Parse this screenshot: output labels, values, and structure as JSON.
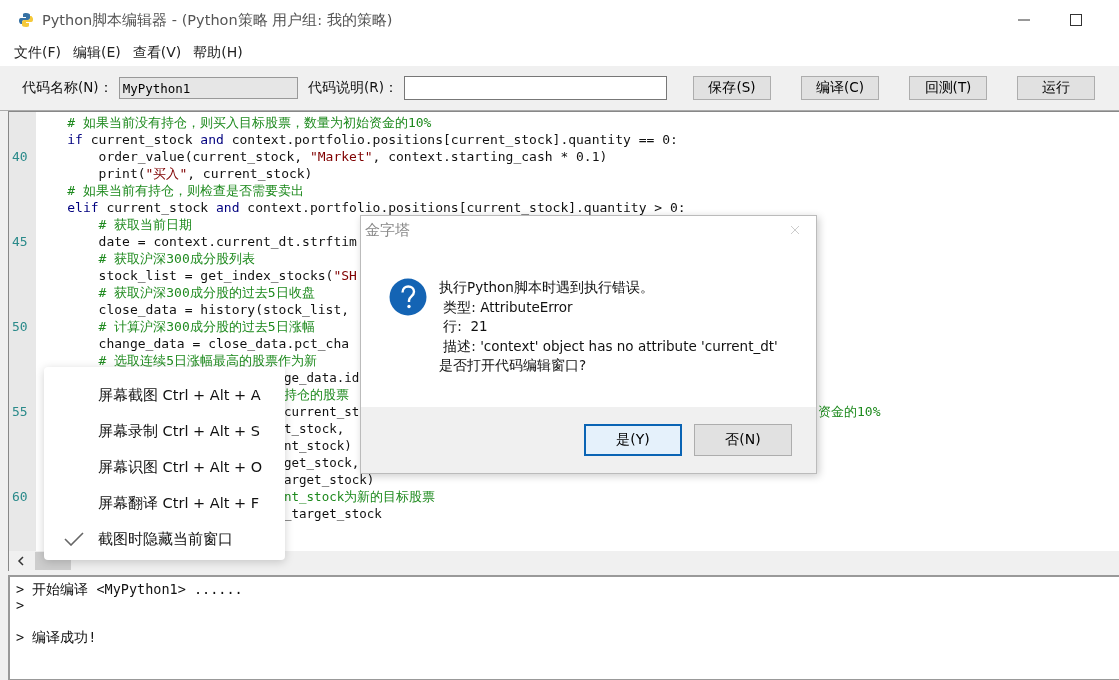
{
  "window": {
    "title": "Python脚本编辑器 - (Python策略 用户组: 我的策略)"
  },
  "menu_bar": [
    "文件(F)",
    "编辑(E)",
    "查看(V)",
    "帮助(H)"
  ],
  "toolbar": {
    "name_label": "代码名称(N)：",
    "name_value": "MyPython1",
    "desc_label": "代码说明(R)：",
    "buttons": [
      "保存(S)",
      "编译(C)",
      "回测(T)",
      "运行"
    ]
  },
  "code_lines": [
    {
      "segments": [
        {
          "kind": "full",
          "tokens": [
            {
              "kind": "comment",
              "t": "# 如果当前没有持仓，则买入目标股票，数量为初始资金的10%"
            }
          ]
        }
      ]
    },
    {
      "segments": [
        {
          "kind": "full",
          "tokens": [
            {
              "kind": "keyword",
              "t": "if"
            },
            {
              "kind": "plain",
              "t": " current_stock "
            },
            {
              "kind": "keyword",
              "t": "and"
            },
            {
              "kind": "plain",
              "t": " context.portfolio.positions[current_stock].quantity == 0:"
            }
          ]
        }
      ],
      "children": [
        {
          "number": "40",
          "segments": [
            {
              "kind": "full",
              "tokens": [
                {
                  "kind": "plain",
                  "t": "order_value(current_stock, "
                },
                {
                  "kind": "string",
                  "t": "\"Market\""
                },
                {
                  "kind": "plain",
                  "t": ", context.starting_cash * 0.1)"
                }
              ]
            }
          ]
        },
        {
          "segments": [
            {
              "kind": "full",
              "tokens": [
                {
                  "kind": "plain",
                  "t": "print("
                },
                {
                  "kind": "string",
                  "t": "\"买入\""
                },
                {
                  "kind": "plain",
                  "t": ", current_stock)"
                }
              ]
            }
          ]
        }
      ]
    },
    {
      "segments": [
        {
          "kind": "full",
          "tokens": [
            {
              "kind": "comment",
              "t": "# 如果当前有持仓，则检查是否需要卖出"
            }
          ]
        }
      ]
    },
    {
      "segments": [
        {
          "kind": "full",
          "tokens": [
            {
              "kind": "keyword",
              "t": "elif"
            },
            {
              "kind": "plain",
              "t": " current_stock "
            },
            {
              "kind": "keyword",
              "t": "and"
            },
            {
              "kind": "plain",
              "t": " context.portfolio.positions[current_stock].quantity > 0:"
            }
          ]
        }
      ],
      "children": [
        {
          "segments": [
            {
              "kind": "full",
              "tokens": [
                {
                  "kind": "comment",
                  "t": "# 获取当前日期"
                }
              ]
            }
          ]
        },
        {
          "number": "45",
          "segments": [
            {
              "kind": "full",
              "tokens": [
                {
                  "kind": "plain",
                  "t": "date = context.current_dt.strftim"
                }
              ]
            }
          ]
        },
        {
          "segments": [
            {
              "kind": "full",
              "tokens": [
                {
                  "kind": "comment",
                  "t": "# 获取沪深300成分股列表"
                }
              ]
            }
          ]
        },
        {
          "segments": [
            {
              "kind": "full",
              "tokens": [
                {
                  "kind": "plain",
                  "t": "stock_list = get_index_stocks("
                },
                {
                  "kind": "string",
                  "t": "\"SH"
                }
              ]
            }
          ]
        },
        {
          "segments": [
            {
              "kind": "full",
              "tokens": [
                {
                  "kind": "comment",
                  "t": "# 获取沪深300成分股的过去5日收盘"
                }
              ]
            }
          ]
        },
        {
          "segments": [
            {
              "kind": "full",
              "tokens": [
                {
                  "kind": "plain",
                  "t": "close_data = history(stock_list,"
                }
              ]
            }
          ]
        },
        {
          "number": "50",
          "segments": [
            {
              "kind": "full",
              "tokens": [
                {
                  "kind": "comment",
                  "t": "# 计算沪深300成分股的过去5日涨幅"
                }
              ]
            }
          ]
        },
        {
          "segments": [
            {
              "kind": "full",
              "tokens": [
                {
                  "kind": "plain",
                  "t": "change_data = close_data.pct_cha"
                }
              ]
            }
          ]
        },
        {
          "segments": [
            {
              "kind": "full",
              "tokens": [
                {
                  "kind": "comment",
                  "t": "# 选取连续5日涨幅最高的股票作为新"
                }
              ]
            }
          ]
        },
        {
          "segments": [
            {
              "kind": "mid",
              "tokens": [
                {
                  "kind": "plain",
                  "t": "ge_data.id"
                }
              ]
            }
          ]
        },
        {
          "segments": [
            {
              "kind": "mid",
              "tokens": [
                {
                  "kind": "comment",
                  "t": "持仓的股票"
                }
              ]
            },
            {
              "kind": "right",
              "tokens": [
                {
                  "kind": "comment",
                  "t": "资金的10%"
                }
              ]
            }
          ]
        },
        {
          "number": "55",
          "segments": [
            {
              "kind": "mid",
              "tokens": [
                {
                  "kind": "plain",
                  "t": "current_st"
                }
              ]
            }
          ],
          "children": [
            {
              "segments": [
                {
                  "kind": "mid",
                  "tokens": [
                    {
                      "kind": "plain",
                      "t": "t_stock,"
                    }
                  ]
                }
              ]
            },
            {
              "segments": [
                {
                  "kind": "mid",
                  "tokens": [
                    {
                      "kind": "plain",
                      "t": "nt_stock)"
                    }
                  ]
                }
              ]
            },
            {
              "segments": [
                {
                  "kind": "mid",
                  "tokens": [
                    {
                      "kind": "plain",
                      "t": "get_stock,"
                    }
                  ]
                }
              ]
            },
            {
              "segments": [
                {
                  "kind": "mid",
                  "tokens": [
                    {
                      "kind": "plain",
                      "t": "arget_stock)"
                    }
                  ]
                }
              ]
            },
            {
              "number": "60",
              "segments": [
                {
                  "kind": "mid",
                  "tokens": [
                    {
                      "kind": "comment",
                      "t": "nt_stock为新的目标股票"
                    }
                  ]
                }
              ]
            },
            {
              "segments": [
                {
                  "kind": "mid",
                  "tokens": [
                    {
                      "kind": "plain",
                      "t": "_target_stock"
                    }
                  ]
                }
              ]
            }
          ]
        }
      ]
    }
  ],
  "output_lines": [
    "> 开始编译 <MyPython1> ......",
    ">",
    "> 编译成功!"
  ],
  "context_menu": [
    {
      "label": "屏幕截图 Ctrl + Alt + A",
      "checked": false
    },
    {
      "label": "屏幕录制 Ctrl + Alt + S",
      "checked": false
    },
    {
      "label": "屏幕识图 Ctrl + Alt + O",
      "checked": false
    },
    {
      "label": "屏幕翻译 Ctrl + Alt + F",
      "checked": false
    },
    {
      "label": "截图时隐藏当前窗口",
      "checked": true
    }
  ],
  "dialog": {
    "title": "金字塔",
    "message": [
      "执行Python脚本时遇到执行错误。",
      " 类型: AttributeError",
      " 行:  21",
      " 描述: 'context' object has no attribute 'current_dt'",
      "是否打开代码编辑窗口?"
    ],
    "buttons": [
      {
        "label": "是(Y)",
        "selected": true
      },
      {
        "label": "否(N)",
        "selected": false
      }
    ]
  }
}
